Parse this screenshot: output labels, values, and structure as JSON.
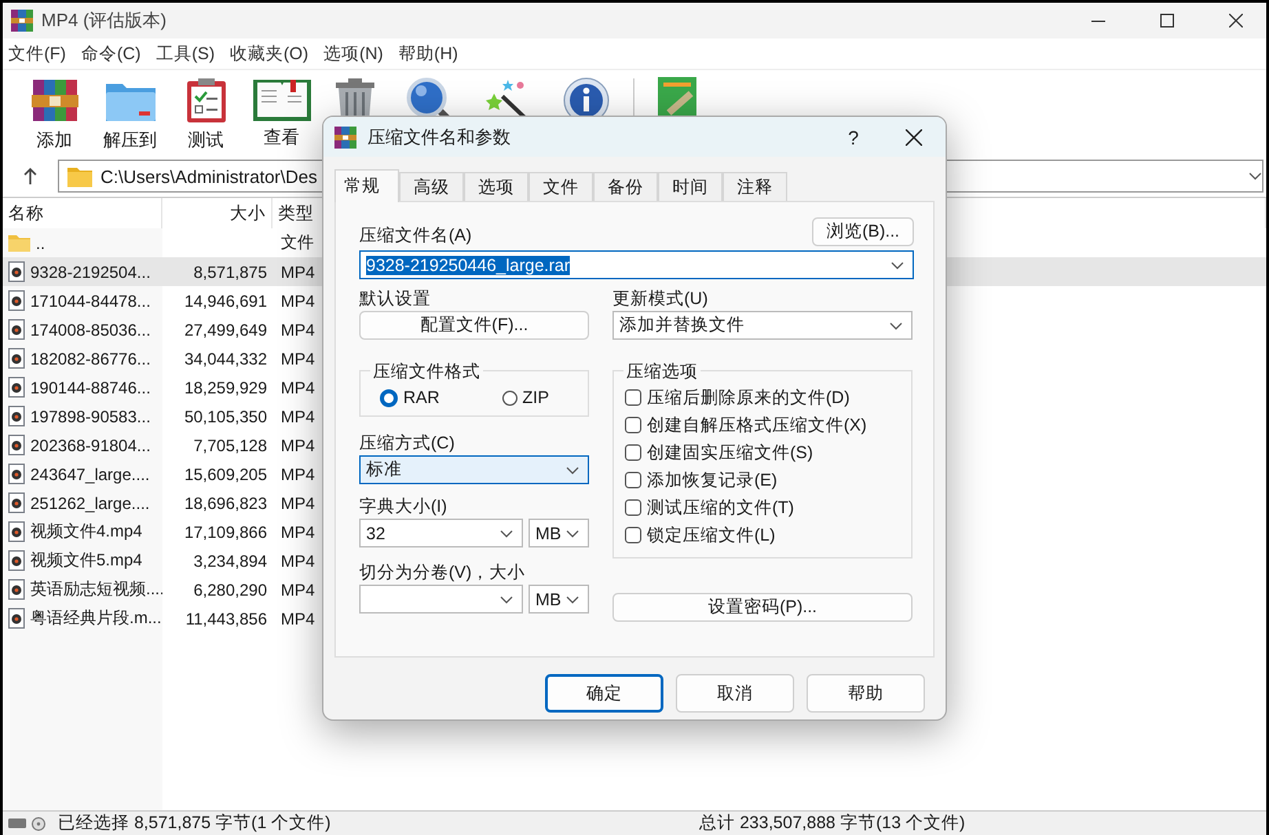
{
  "window": {
    "title": "MP4 (评估版本)"
  },
  "menu": [
    "文件(F)",
    "命令(C)",
    "工具(S)",
    "收藏夹(O)",
    "选项(N)",
    "帮助(H)"
  ],
  "toolbar": {
    "main": [
      {
        "kind": "add",
        "label": "添加"
      },
      {
        "kind": "extract",
        "label": "解压到"
      },
      {
        "kind": "test",
        "label": "测试"
      },
      {
        "kind": "view",
        "label": "查看"
      },
      {
        "kind": "delete"
      },
      {
        "kind": "find"
      },
      {
        "kind": "wizard"
      },
      {
        "kind": "info"
      }
    ],
    "extra": [
      {
        "kind": "repair"
      }
    ]
  },
  "address": {
    "path": "C:\\Users\\Administrator\\Des"
  },
  "file_list": {
    "columns": [
      "名称",
      "大小",
      "类型"
    ],
    "rows": [
      {
        "kind": "folder",
        "name": "..",
        "type": "文件",
        "selected": false
      },
      {
        "kind": "video",
        "name": "9328-2192504...",
        "size": "8,571,875",
        "type": "MP4",
        "selected": true
      },
      {
        "kind": "video",
        "name": "171044-84478...",
        "size": "14,946,691",
        "type": "MP4",
        "selected": false
      },
      {
        "kind": "video",
        "name": "174008-85036...",
        "size": "27,499,649",
        "type": "MP4",
        "selected": false
      },
      {
        "kind": "video",
        "name": "182082-86776...",
        "size": "34,044,332",
        "type": "MP4",
        "selected": false
      },
      {
        "kind": "video",
        "name": "190144-88746...",
        "size": "18,259,929",
        "type": "MP4",
        "selected": false
      },
      {
        "kind": "video",
        "name": "197898-90583...",
        "size": "50,105,350",
        "type": "MP4",
        "selected": false
      },
      {
        "kind": "video",
        "name": "202368-91804...",
        "size": "7,705,128",
        "type": "MP4",
        "selected": false
      },
      {
        "kind": "video",
        "name": "243647_large....",
        "size": "15,609,205",
        "type": "MP4",
        "selected": false
      },
      {
        "kind": "video",
        "name": "251262_large....",
        "size": "18,696,823",
        "type": "MP4",
        "selected": false
      },
      {
        "kind": "video",
        "name": "视频文件4.mp4",
        "size": "17,109,866",
        "type": "MP4",
        "selected": false
      },
      {
        "kind": "video",
        "name": "视频文件5.mp4",
        "size": "3,234,894",
        "type": "MP4",
        "selected": false
      },
      {
        "kind": "video",
        "name": "英语励志短视频....",
        "size": "6,280,290",
        "type": "MP4",
        "selected": false
      },
      {
        "kind": "video",
        "name": "粤语经典片段.m...",
        "size": "11,443,856",
        "type": "MP4",
        "selected": false
      }
    ]
  },
  "status_bar": {
    "selection": "已经选择 8,571,875 字节(1 个文件)",
    "total": "总计 233,507,888 字节(13 个文件)"
  },
  "dialog": {
    "title": "压缩文件名和参数",
    "help": "?",
    "tabs": [
      {
        "label": "常规",
        "selected": true
      },
      {
        "label": "高级",
        "selected": false
      },
      {
        "label": "选项",
        "selected": false
      },
      {
        "label": "文件",
        "selected": false
      },
      {
        "label": "备份",
        "selected": false
      },
      {
        "label": "时间",
        "selected": false
      },
      {
        "label": "注释",
        "selected": false
      }
    ],
    "archive_name": {
      "label": "压缩文件名(A)",
      "value": "9328-219250446_large.rar",
      "text_selected": true
    },
    "browse_button": "浏览(B)...",
    "profiles": {
      "label": "默认设置",
      "button": "配置文件(F)..."
    },
    "update_mode": {
      "label": "更新模式(U)",
      "value": "添加并替换文件"
    },
    "format": {
      "label": "压缩文件格式",
      "options": [
        {
          "label": "RAR",
          "selected": true
        },
        {
          "label": "ZIP",
          "selected": false
        }
      ]
    },
    "method": {
      "label": "压缩方式(C)",
      "value": "标准"
    },
    "dictionary": {
      "label": "字典大小(I)",
      "value": "32",
      "unit": "MB"
    },
    "split": {
      "label": "切分为分卷(V)，大小",
      "unit": "MB"
    },
    "options": {
      "label": "压缩选项",
      "items": [
        {
          "label": "压缩后删除原来的文件(D)",
          "checked": false
        },
        {
          "label": "创建自解压格式压缩文件(X)",
          "checked": false
        },
        {
          "label": "创建固实压缩文件(S)",
          "checked": false
        },
        {
          "label": "添加恢复记录(E)",
          "checked": false
        },
        {
          "label": "测试压缩的文件(T)",
          "checked": false
        },
        {
          "label": "锁定压缩文件(L)",
          "checked": false
        }
      ]
    },
    "password_button": "设置密码(P)...",
    "buttons": [
      {
        "label": "确定",
        "default": true
      },
      {
        "label": "取消",
        "default": false
      },
      {
        "label": "帮助",
        "default": false
      }
    ]
  }
}
